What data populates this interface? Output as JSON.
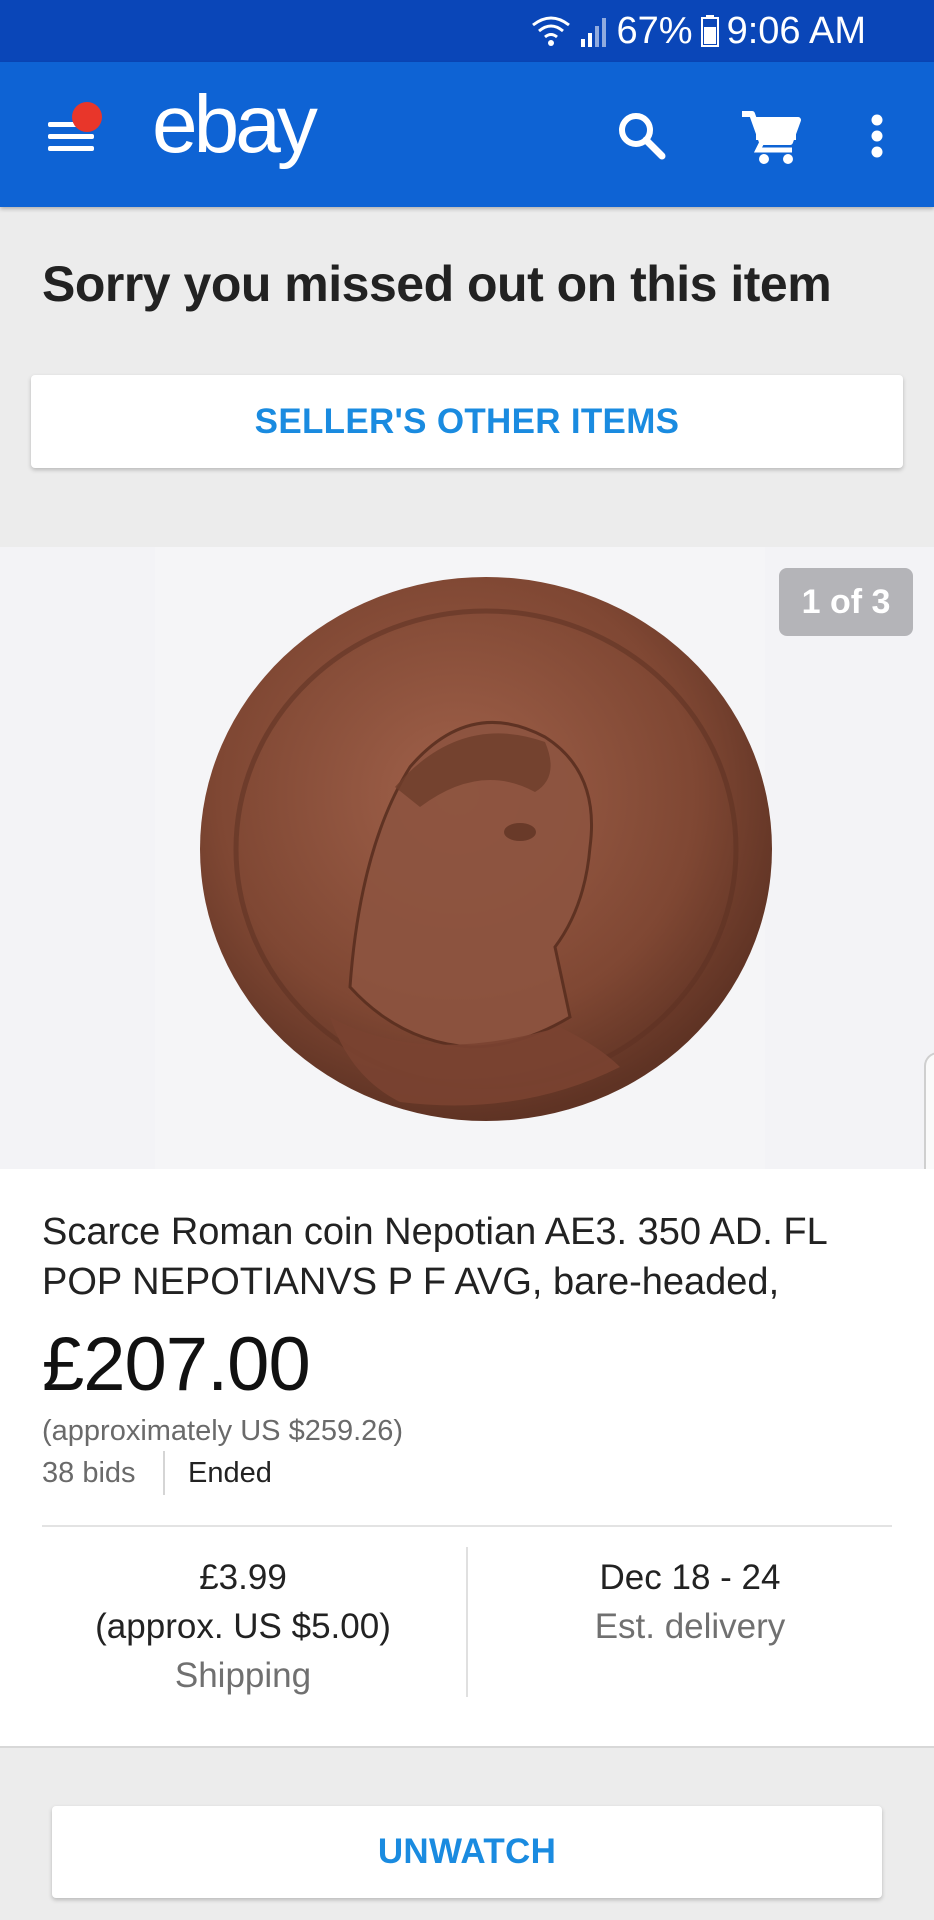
{
  "status_bar": {
    "battery": "67%",
    "time": "9:06 AM"
  },
  "app_bar": {
    "logo": "ebay"
  },
  "notice": {
    "heading": "Sorry you missed out on this item",
    "sellers_items_button": "SELLER'S OTHER ITEMS"
  },
  "gallery": {
    "counter": "1 of 3"
  },
  "listing": {
    "title": "Scarce Roman coin Nepotian AE3. 350 AD. FL POP NEPOTIANVS P F AVG, bare-headed,",
    "price": "£207.00",
    "approx_price": "(approximately US $259.26)",
    "bids": "38 bids",
    "status": "Ended"
  },
  "shipping": {
    "cost": "£3.99",
    "approx": "(approx. US $5.00)",
    "label": "Shipping"
  },
  "delivery": {
    "dates": "Dec 18 - 24",
    "label": "Est. delivery"
  },
  "actions": {
    "unwatch": "UNWATCH"
  },
  "colors": {
    "status_bar": "#0a46b8",
    "app_bar": "#0e63d4",
    "accent_link": "#1a8be0",
    "notification_dot": "#e8362a"
  }
}
